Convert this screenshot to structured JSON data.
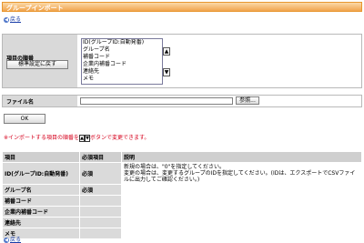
{
  "page": {
    "title": "グループインポート",
    "back_label": "戻る"
  },
  "order": {
    "label": "項目の順番",
    "reset_button": "標準設定に戻す",
    "items": [
      "ID(グループID:自動発番)",
      "グループ名",
      "補番コード",
      "企業内補番コード",
      "連絡先",
      "メモ"
    ],
    "up_icon": "▲",
    "down_icon": "▼"
  },
  "file": {
    "label": "ファイル名",
    "value": "",
    "browse_button": "参照..."
  },
  "ok_button": "OK",
  "note": {
    "before": "※インポートする項目の順番を",
    "after": "ボタンで変更できます。"
  },
  "table": {
    "headers": [
      "項目",
      "必須項目",
      "説明"
    ],
    "rows": [
      {
        "name": "ID(グループID:自動発番)",
        "required": "必須",
        "desc": "新規の場合は、\"0\"を指定してください。\n変更の場合は、変更するグループのIDを指定してください。(IDは、エクスポートでCSVファイルに出力してご確認ください。)"
      },
      {
        "name": "グループ名",
        "required": "必須",
        "desc": ""
      },
      {
        "name": "補番コード",
        "required": "",
        "desc": ""
      },
      {
        "name": "企業内補番コード",
        "required": "",
        "desc": ""
      },
      {
        "name": "連絡先",
        "required": "",
        "desc": ""
      },
      {
        "name": "メモ",
        "required": "",
        "desc": ""
      }
    ]
  }
}
